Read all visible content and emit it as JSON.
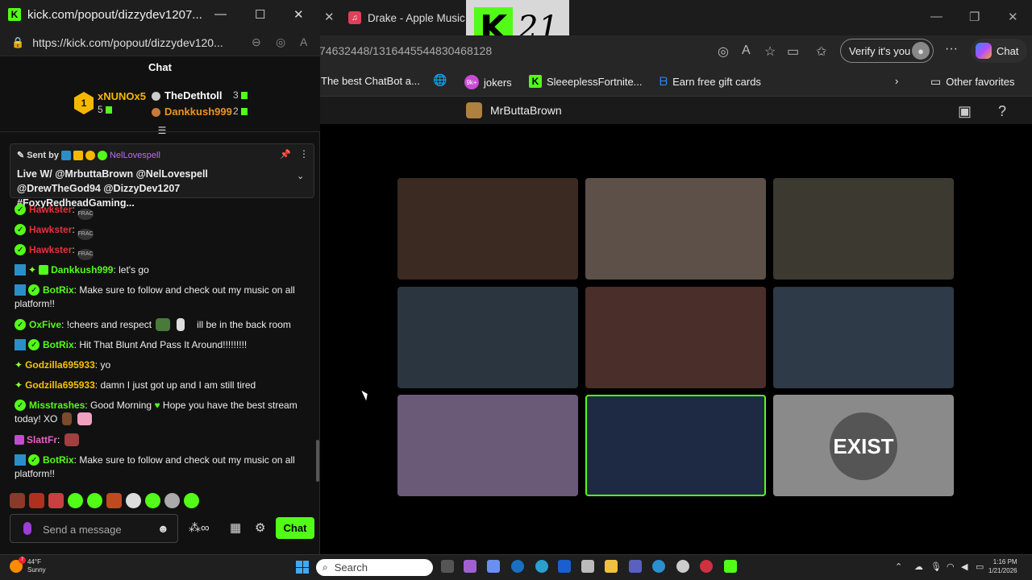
{
  "popout": {
    "window_title": "kick.com/popout/dizzydev1207...",
    "url": "https://kick.com/popout/dizzydev120...",
    "chat_title": "Chat"
  },
  "leaderboard": [
    {
      "rank": "1",
      "name": "xNUNOx5",
      "count": "5"
    },
    {
      "rank": "2",
      "name": "TheDethtoll",
      "count": "3"
    },
    {
      "rank": "3",
      "name": "Dankkush999",
      "count": "2"
    }
  ],
  "pinned": {
    "sent_by_label": "Sent by",
    "sender": "NelLovespell",
    "message": "Live W/ @MrbuttaBrown @NelLovespell @DrewTheGod94 @DizzyDev1207 #FoxyRedheadGaming..."
  },
  "messages": [
    {
      "user": "Hawkster",
      "color": "#e8303a",
      "text": "",
      "badges": "v",
      "frac": true
    },
    {
      "user": "Hawkster",
      "color": "#e8303a",
      "text": "",
      "badges": "v",
      "frac": true
    },
    {
      "user": "Hawkster",
      "color": "#e8303a",
      "text": "",
      "badges": "v",
      "frac": true
    },
    {
      "user": "Dankkush999",
      "color": "#53fc18",
      "text": " let's go",
      "badges": "s*g"
    },
    {
      "user": "BotRix",
      "color": "#53fc18",
      "text": " Make sure to follow and check out my music on all platform!!",
      "badges": "sv"
    },
    {
      "user": "OxFive",
      "color": "#53fc18",
      "text": " !cheers and respect",
      "text2": "ill be in the back room",
      "badges": "v"
    },
    {
      "user": "BotRix",
      "color": "#53fc18",
      "text": " Hit That Blunt And Pass It Around!!!!!!!!!",
      "badges": "sv"
    },
    {
      "user": "Godzilla695933",
      "color": "#f5c400",
      "text": " yo",
      "badges": "*"
    },
    {
      "user": "Godzilla695933",
      "color": "#f5c400",
      "text": " damn I just got up and I am still tired",
      "badges": "*"
    },
    {
      "user": "Misstrashes",
      "color": "#53fc18",
      "text": " Good Morning",
      "text2": "Hope you have the best stream today! XO",
      "badges": "v"
    },
    {
      "user": "SlattFr",
      "color": "#e860c8",
      "text": "",
      "badges": "p"
    },
    {
      "user": "BotRix",
      "color": "#53fc18",
      "text": " Make sure to follow and check out my music on all platform!!",
      "badges": "sv"
    }
  ],
  "composer": {
    "placeholder": "Send a message",
    "send_label": "Chat"
  },
  "browser": {
    "tab_title": "Drake - Apple Music",
    "overlay_number": "21",
    "url_fragment": "74632448/1316445544830468128",
    "verify_label": "Verify it's you",
    "copilot_label": "Chat",
    "favorites": [
      {
        "label": "The best ChatBot a..."
      },
      {
        "label": "jokers"
      },
      {
        "label": "SleeeplessFortnite..."
      },
      {
        "label": "Earn free gift cards"
      }
    ],
    "other_favorites": "Other favorites",
    "favorites_badge": "9k+",
    "streamer": "MrButtaBrown"
  },
  "video_tiles": [
    {
      "bg": "#3a2a22"
    },
    {
      "bg": "#5d5048"
    },
    {
      "bg": "#3c3a30"
    },
    {
      "bg": "#2a3540"
    },
    {
      "bg": "#4a2e2a"
    },
    {
      "bg": "#2e3a48"
    },
    {
      "bg": "#6a5a78"
    },
    {
      "bg": "#1e2a44"
    },
    {
      "bg": "#8a8a8a"
    }
  ],
  "tile_exist_text": "EXIST",
  "taskbar": {
    "temp": "44°F",
    "condition": "Sunny",
    "weather_badge": "7",
    "search_placeholder": "Search",
    "time": "1:16 PM",
    "date": "1/21/2026"
  }
}
